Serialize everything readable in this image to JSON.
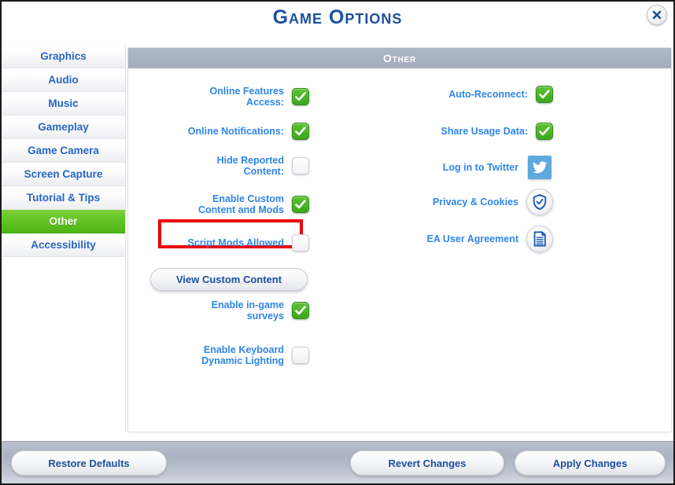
{
  "window": {
    "title": "Game Options",
    "close_icon": "close-x-icon"
  },
  "sidebar": {
    "items": [
      {
        "label": "Graphics",
        "selected": false
      },
      {
        "label": "Audio",
        "selected": false
      },
      {
        "label": "Music",
        "selected": false
      },
      {
        "label": "Gameplay",
        "selected": false
      },
      {
        "label": "Game Camera",
        "selected": false
      },
      {
        "label": "Screen Capture",
        "selected": false
      },
      {
        "label": "Tutorial & Tips",
        "selected": false
      },
      {
        "label": "Other",
        "selected": true
      },
      {
        "label": "Accessibility",
        "selected": false
      }
    ],
    "selected_color": "#63c422"
  },
  "content": {
    "section_header": "Other",
    "left_column": [
      {
        "label": "Online Features\nAccess:",
        "control": "checkbox",
        "checked": true
      },
      {
        "label": "Online Notifications:",
        "control": "checkbox",
        "checked": true
      },
      {
        "label": "Hide Reported\nContent:",
        "control": "checkbox",
        "checked": false
      },
      {
        "label": "Enable Custom\nContent and Mods",
        "control": "checkbox",
        "checked": true,
        "highlighted": true
      },
      {
        "label": "Script Mods Allowed",
        "control": "checkbox",
        "checked": false
      },
      {
        "label": "Enable in-game\nsurveys",
        "control": "checkbox",
        "checked": true
      },
      {
        "label": "Enable Keyboard\nDynamic Lighting",
        "control": "checkbox",
        "checked": false
      }
    ],
    "view_custom_content_label": "View Custom Content",
    "right_column": [
      {
        "label": "Auto-Reconnect:",
        "control": "checkbox",
        "checked": true
      },
      {
        "label": "Share Usage Data:",
        "control": "checkbox",
        "checked": true
      },
      {
        "label": "Log in to Twitter",
        "control": "icon",
        "icon": "twitter-bird-icon"
      },
      {
        "label": "Privacy & Cookies",
        "control": "icon",
        "icon": "shield-check-icon"
      },
      {
        "label": "EA User Agreement",
        "control": "icon",
        "icon": "document-icon"
      }
    ],
    "highlight_color": "#ee0000"
  },
  "footer": {
    "restore_defaults": "Restore Defaults",
    "revert_changes": "Revert Changes",
    "apply_changes": "Apply Changes"
  },
  "colors": {
    "label_blue": "#2f86e8",
    "title_blue": "#1c4fa0",
    "header_band": "#a3adbe",
    "check_green": "#3da81c",
    "twitter_blue": "#5ea9dd"
  }
}
